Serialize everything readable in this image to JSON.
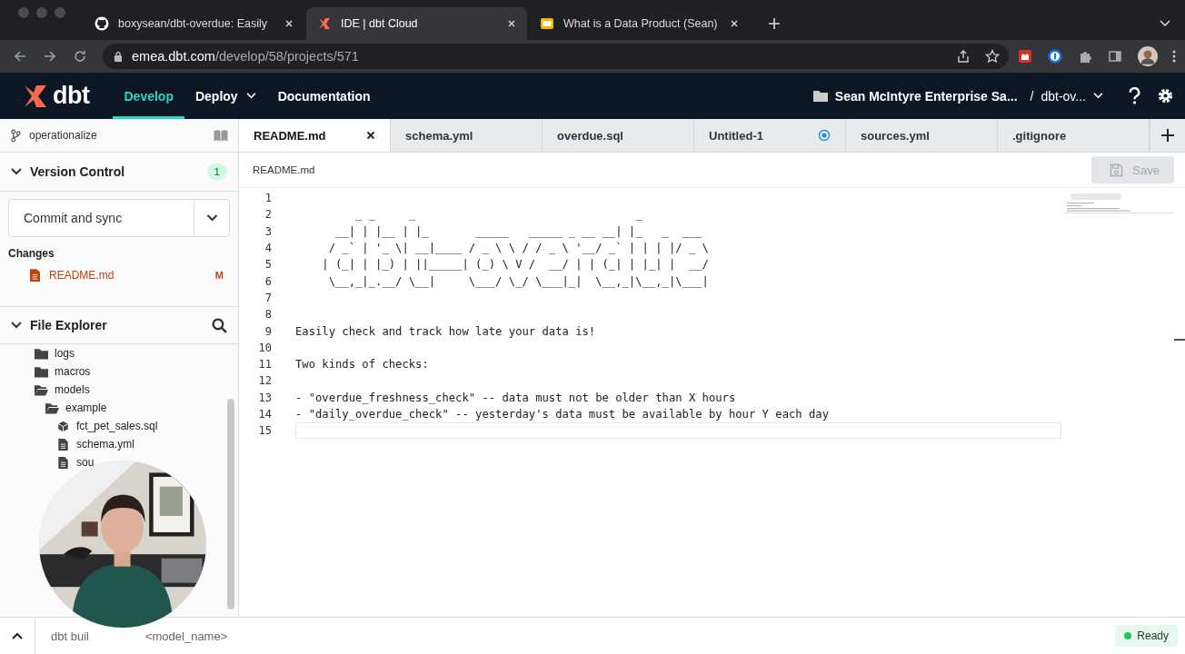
{
  "browser": {
    "tabs": [
      {
        "title": "boxysean/dbt-overdue: Easily",
        "kind": "github",
        "selected": false
      },
      {
        "title": "IDE | dbt Cloud",
        "kind": "dbt",
        "selected": true
      },
      {
        "title": "What is a Data Product (Sean)",
        "kind": "slides",
        "selected": false
      }
    ],
    "url_host": "emea.dbt.com",
    "url_path": "/develop/58/projects/571"
  },
  "app_header": {
    "logo": "dbt",
    "nav": [
      {
        "label": "Develop",
        "selected": true,
        "has_menu": false
      },
      {
        "label": "Deploy",
        "selected": false,
        "has_menu": true
      },
      {
        "label": "Documentation",
        "selected": false,
        "has_menu": false
      }
    ],
    "project": "Sean McIntyre Enterprise Sa...",
    "separator": "/",
    "repo": "dbt-ov..."
  },
  "sidebar": {
    "branch": "operationalize",
    "version_control": {
      "title": "Version Control",
      "count": "1",
      "expanded": true,
      "action": "Commit and sync",
      "changes_label": "Changes",
      "changes": [
        {
          "name": "README.md",
          "status": "M"
        }
      ]
    },
    "file_explorer": {
      "title": "File Explorer",
      "expanded": true,
      "tree": [
        {
          "name": "logs",
          "kind": "folder",
          "expanded": false
        },
        {
          "name": "macros",
          "kind": "folder",
          "expanded": false
        },
        {
          "name": "models",
          "kind": "folder",
          "expanded": true,
          "children": [
            {
              "name": "example",
              "kind": "folder",
              "expanded": true,
              "children": [
                {
                  "name": "fct_pet_sales.sql",
                  "kind": "model"
                },
                {
                  "name": "schema.yml",
                  "kind": "file"
                },
                {
                  "name": "sou",
                  "kind": "file"
                }
              ]
            }
          ]
        }
      ]
    }
  },
  "editor": {
    "tabs": [
      {
        "label": "README.md",
        "selected": true,
        "closable": true,
        "unsaved": false
      },
      {
        "label": "schema.yml",
        "selected": false,
        "closable": false,
        "unsaved": false
      },
      {
        "label": "overdue.sql",
        "selected": false,
        "closable": false,
        "unsaved": false
      },
      {
        "label": "Untitled-1",
        "selected": false,
        "closable": false,
        "unsaved": true
      },
      {
        "label": "sources.yml",
        "selected": false,
        "closable": false,
        "unsaved": false
      },
      {
        "label": ".gitignore",
        "selected": false,
        "closable": false,
        "unsaved": false
      }
    ],
    "breadcrumb": "README.md",
    "save": {
      "label": "Save",
      "disabled": true
    },
    "lines": [
      {
        "number": "1",
        "active": false
      },
      {
        "number": "2",
        "text": "         _ _     _                                 _",
        "active": false
      },
      {
        "number": "3",
        "text": "      __| | |__ | |_       _____   _____ _ __ __| |_   _  ___",
        "active": false
      },
      {
        "number": "4",
        "text": "     / _` | '_ \\| __|____ / _ \\ \\ / / _ \\ '__/ _` | | | |/ _ \\",
        "active": false
      },
      {
        "number": "5",
        "text": "    | (_| | |_) | ||_____| (_) \\ V /  __/ | | (_| | |_| |  __/",
        "active": false
      },
      {
        "number": "6",
        "text": "     \\__,_|_.__/ \\__|     \\___/ \\_/ \\___|_|  \\__,_|\\__,_|\\___|",
        "active": false
      },
      {
        "number": "7",
        "active": false
      },
      {
        "number": "8",
        "active": false
      },
      {
        "number": "9",
        "text": "Easily check and track how late your data is!",
        "active": false
      },
      {
        "number": "10",
        "active": false
      },
      {
        "number": "11",
        "text": "Two kinds of checks:",
        "active": false
      },
      {
        "number": "12",
        "active": false
      },
      {
        "number": "13",
        "text": "- \"overdue_freshness_check\" -- data must not be older than X hours",
        "active": false
      },
      {
        "number": "14",
        "text": "- \"daily_overdue_check\" -- yesterday's data must be available by hour Y each day",
        "active": false
      },
      {
        "number": "15",
        "active": true
      }
    ]
  },
  "command_bar": {
    "placeholder_parts": [
      "dbt buil",
      "<model_name>"
    ]
  },
  "status": {
    "label": "Ready",
    "color": "#22c55e"
  }
}
